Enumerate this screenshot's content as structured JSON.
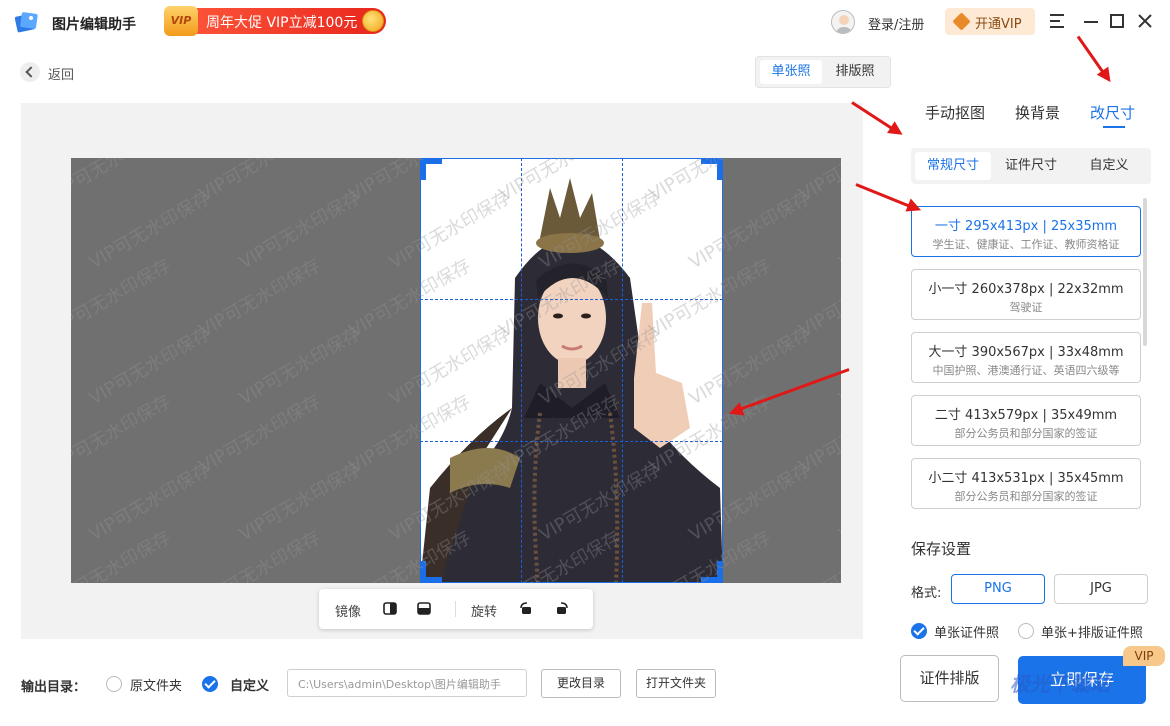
{
  "app": {
    "title": "图片编辑助手"
  },
  "promo": {
    "badge": "VIP",
    "text": "周年大促 VIP立减100元"
  },
  "header": {
    "login_label": "登录/注册",
    "vip_label": "开通VIP"
  },
  "nav": {
    "back_label": "返回",
    "modes": [
      "单张照",
      "排版照"
    ]
  },
  "canvas": {
    "watermark_text": "VIP可无水印保存"
  },
  "toolbar": {
    "mirror_label": "镜像",
    "rotate_label": "旋转"
  },
  "right_tabs": [
    "手动抠图",
    "换背景",
    "改尺寸"
  ],
  "size_tabs": [
    "常规尺寸",
    "证件尺寸",
    "自定义"
  ],
  "sizes": [
    {
      "title": "一寸 295x413px | 25x35mm",
      "desc": "学生证、健康证、工作证、教师资格证"
    },
    {
      "title": "小一寸 260x378px | 22x32mm",
      "desc": "驾驶证"
    },
    {
      "title": "大一寸 390x567px | 33x48mm",
      "desc": "中国护照、港澳通行证、英语四六级等"
    },
    {
      "title": "二寸 413x579px | 35x49mm",
      "desc": "部分公务员和部分国家的签证"
    },
    {
      "title": "小二寸 413x531px | 35x45mm",
      "desc": "部分公务员和部分国家的签证"
    }
  ],
  "save": {
    "title": "保存设置",
    "format_label": "格式:",
    "formats": [
      "PNG",
      "JPG"
    ],
    "option_single": "单张证件照",
    "option_both": "单张+排版证件照",
    "layout_button": "证件排版",
    "save_button": "立即保存",
    "vip_tag": "VIP"
  },
  "output": {
    "label": "输出目录：",
    "option_original": "原文件夹",
    "option_custom": "自定义",
    "path": "C:\\Users\\admin\\Desktop\\图片编辑助手",
    "change_button": "更改目录",
    "open_button": "打开文件夹"
  },
  "site_watermark": "极光下载站",
  "colors": {
    "accent": "#1a73e8",
    "promo": "#e8261c",
    "annotation_arrow": "#e01818"
  }
}
